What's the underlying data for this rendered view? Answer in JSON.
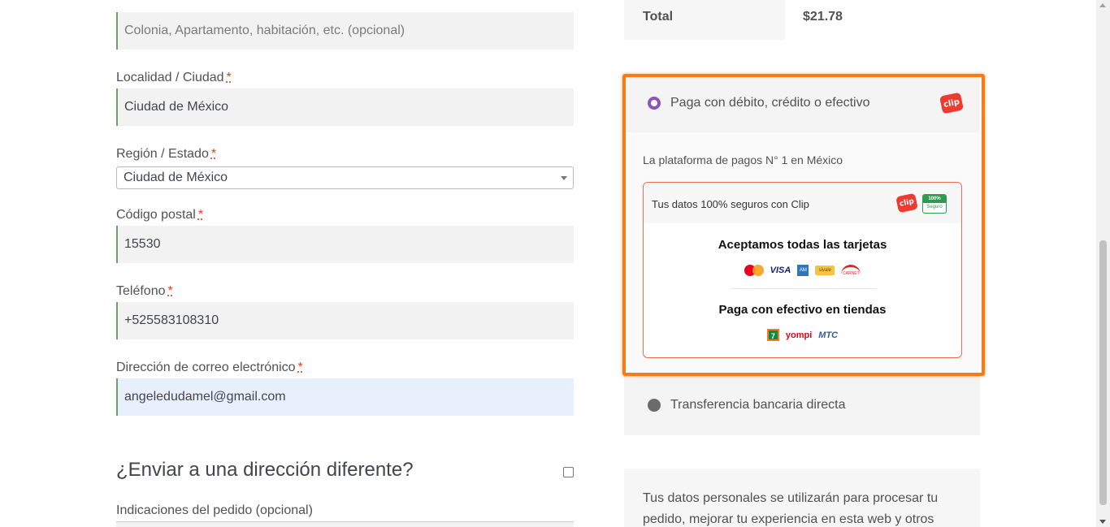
{
  "form": {
    "apartment_placeholder": "Colonia, Apartamento, habitación, etc. (opcional)",
    "city_label": "Localidad / Ciudad",
    "city_value": "Ciudad de México",
    "state_label": "Región / Estado",
    "state_value": "Ciudad de México",
    "postcode_label": "Código postal",
    "postcode_value": "15530",
    "phone_label": "Teléfono",
    "phone_value": "+525583108310",
    "email_label": "Dirección de correo electrónico",
    "email_value": "angeledudamel@gmail.com",
    "required_mark": "*",
    "ship_different_heading": "¿Enviar a una dirección diferente?",
    "notes_label": "Indicaciones del pedido (opcional)"
  },
  "order": {
    "total_label": "Total",
    "total_value": "$21.78"
  },
  "payment": {
    "clip_method_label": "Paga con débito, crédito o efectivo",
    "clip_logo_text": "clip",
    "platform_text": "La plataforma de pagos N° 1 en México",
    "secure_text": "Tus datos 100% seguros con Clip",
    "secure_badge_top": "100%",
    "secure_badge_bottom": "Seguro",
    "cards_title": "Aceptamos todas las tarjetas",
    "cash_title": "Paga con efectivo en tiendas",
    "card_logos": {
      "visa": "VISA",
      "amex": "AM",
      "sivale": "sivale",
      "carnet": "CARNET"
    },
    "store_logos": {
      "seven": "7",
      "yompi": "yompi",
      "mtc": "MTC"
    },
    "transfer_method_label": "Transferencia bancaria directa",
    "highlight_color": "#f57c16",
    "radio_color": "#8a56b8"
  },
  "privacy": {
    "text": "Tus datos personales se utilizarán para procesar tu pedido, mejorar tu experiencia en esta web y otros propósitos"
  }
}
